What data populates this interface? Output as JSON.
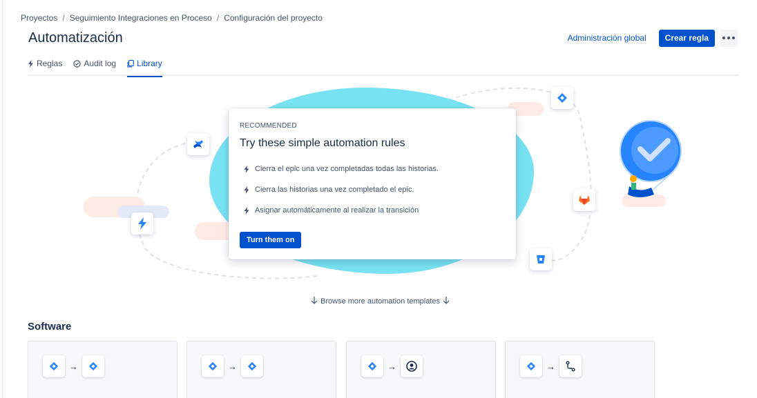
{
  "breadcrumbs": [
    "Proyectos",
    "Seguimiento Integraciones en Proceso",
    "Configuración del proyecto"
  ],
  "page": {
    "title": "Automatización"
  },
  "header": {
    "global_admin": "Administración global",
    "create_rule": "Crear regla",
    "more_icon": "more-horizontal-icon"
  },
  "tabs": [
    {
      "label": "Reglas",
      "icon": "bolt-icon"
    },
    {
      "label": "Audit log",
      "icon": "check-circle-icon"
    },
    {
      "label": "Library",
      "icon": "copy-icon",
      "active": true
    }
  ],
  "hero": {
    "kicker": "RECOMMENDED",
    "title": "Try these simple automation rules",
    "rules": [
      "Cierra el epic una vez completadas todas las historias.",
      "Cierra las historias una vez completado el epic.",
      "Asignar automáticamente al realizar la transición"
    ],
    "button": "Turn them on"
  },
  "browse": "Browse more automation templates",
  "section": {
    "title": "Software"
  },
  "templates": [
    {
      "from": "jira-icon",
      "to": "jira-icon"
    },
    {
      "from": "jira-icon",
      "to": "jira-icon"
    },
    {
      "from": "jira-icon",
      "to": "user-circle-icon"
    },
    {
      "from": "jira-icon",
      "to": "branch-icon"
    }
  ],
  "colors": {
    "brand": "#0052cc",
    "blob": "#79e2f2",
    "text": "#172b4d"
  }
}
